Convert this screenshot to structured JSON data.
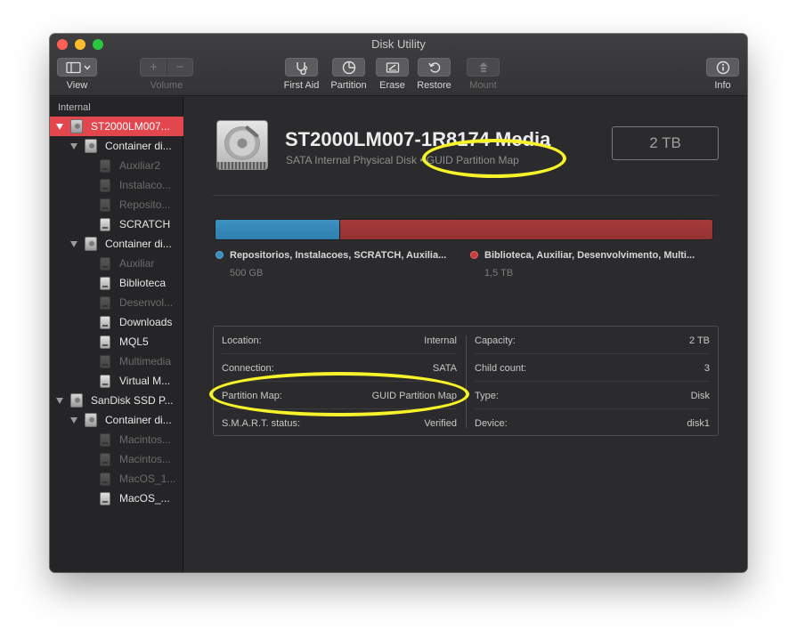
{
  "window": {
    "title": "Disk Utility",
    "colors": {
      "selection": "#e3464d",
      "used_segment": "#2d7fae",
      "other_segment": "#943232",
      "annotation": "#f7f32a"
    }
  },
  "toolbar": {
    "view": {
      "label": "View",
      "icon": "sidebar-icon"
    },
    "volume": {
      "label": "Volume",
      "add_icon": "plus-icon",
      "remove_icon": "minus-icon",
      "add_glyph": "+",
      "remove_glyph": "−"
    },
    "first_aid": {
      "label": "First Aid",
      "icon": "stethoscope-icon"
    },
    "partition": {
      "label": "Partition",
      "icon": "pie-icon"
    },
    "erase": {
      "label": "Erase",
      "icon": "erase-icon"
    },
    "restore": {
      "label": "Restore",
      "icon": "restore-icon"
    },
    "mount": {
      "label": "Mount",
      "icon": "mount-icon"
    },
    "info": {
      "label": "Info",
      "icon": "info-icon"
    }
  },
  "sidebar": {
    "section_label": "Internal",
    "items": [
      {
        "label": "ST2000LM007...",
        "kind": "disk"
      },
      {
        "label": "Container di...",
        "kind": "container"
      },
      {
        "label": "Auxiliar2",
        "kind": "volume"
      },
      {
        "label": "Instalaco...",
        "kind": "volume"
      },
      {
        "label": "Reposito...",
        "kind": "volume"
      },
      {
        "label": "SCRATCH",
        "kind": "volume"
      },
      {
        "label": "Container di...",
        "kind": "container"
      },
      {
        "label": "Auxiliar",
        "kind": "volume"
      },
      {
        "label": "Biblioteca",
        "kind": "volume"
      },
      {
        "label": "Desenvol...",
        "kind": "volume"
      },
      {
        "label": "Downloads",
        "kind": "volume"
      },
      {
        "label": "MQL5",
        "kind": "volume"
      },
      {
        "label": "Multimedia",
        "kind": "volume"
      },
      {
        "label": "Virtual M...",
        "kind": "volume"
      },
      {
        "label": "SanDisk SSD P...",
        "kind": "disk"
      },
      {
        "label": "Container di...",
        "kind": "container"
      },
      {
        "label": "Macintos...",
        "kind": "volume"
      },
      {
        "label": "Macintos...",
        "kind": "volume"
      },
      {
        "label": "MacOS_1...",
        "kind": "volume"
      },
      {
        "label": "MacOS_...",
        "kind": "volume"
      }
    ]
  },
  "detail": {
    "disk_name": "ST2000LM007-1R8174 Media",
    "subtitle": "SATA Internal Physical Disk • GUID Partition Map",
    "size": "2 TB",
    "usage": {
      "segments": [
        {
          "title": "Repositorios, Instalacoes, SCRATCH, Auxilia...",
          "size": "500 GB",
          "fraction": 0.25,
          "color": "#2d7fae"
        },
        {
          "title": "Biblioteca, Auxiliar, Desenvolvimento, Multi...",
          "size": "1,5 TB",
          "fraction": 0.75,
          "color": "#943232"
        }
      ]
    },
    "info_left": [
      {
        "key": "Location:",
        "value": "Internal"
      },
      {
        "key": "Connection:",
        "value": "SATA"
      },
      {
        "key": "Partition Map:",
        "value": "GUID Partition Map"
      },
      {
        "key": "S.M.A.R.T. status:",
        "value": "Verified"
      }
    ],
    "info_right": [
      {
        "key": "Capacity:",
        "value": "2 TB"
      },
      {
        "key": "Child count:",
        "value": "3"
      },
      {
        "key": "Type:",
        "value": "Disk"
      },
      {
        "key": "Device:",
        "value": "disk1"
      }
    ]
  }
}
